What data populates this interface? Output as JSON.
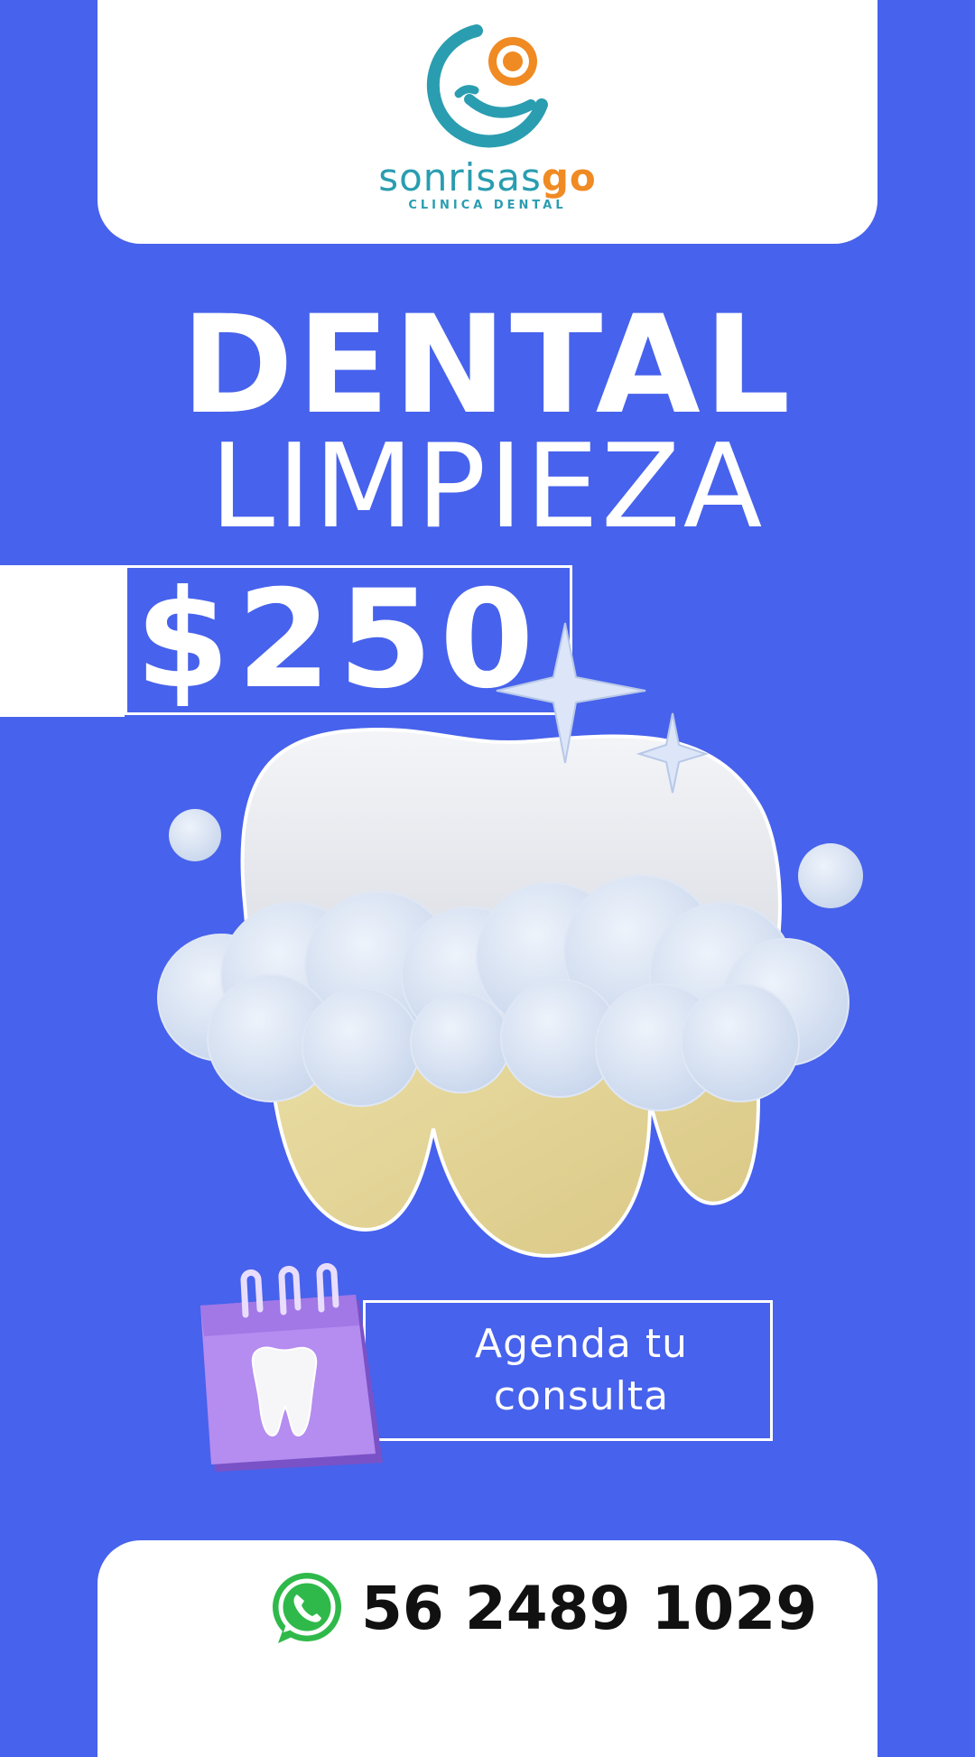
{
  "brand": {
    "name_part1": "sonrisas",
    "name_part2": "go",
    "subtitle": "CLINICA DENTAL"
  },
  "headline": {
    "line1": "DENTAL",
    "line2": "LIMPIEZA"
  },
  "price": "$250",
  "cta": {
    "line1": "Agenda tu",
    "line2": "consulta"
  },
  "contact": {
    "phone": "56 2489 1029"
  },
  "colors": {
    "background": "#4762ec",
    "brand_teal": "#2a9db0",
    "brand_orange": "#f08a23",
    "calendar_purple": "#b58cf0",
    "whatsapp_green": "#2fb94a"
  },
  "icons": [
    "sonrisasgo-logo-icon",
    "sparkle-icon",
    "calendar-icon",
    "tooth-icon",
    "whatsapp-icon"
  ]
}
